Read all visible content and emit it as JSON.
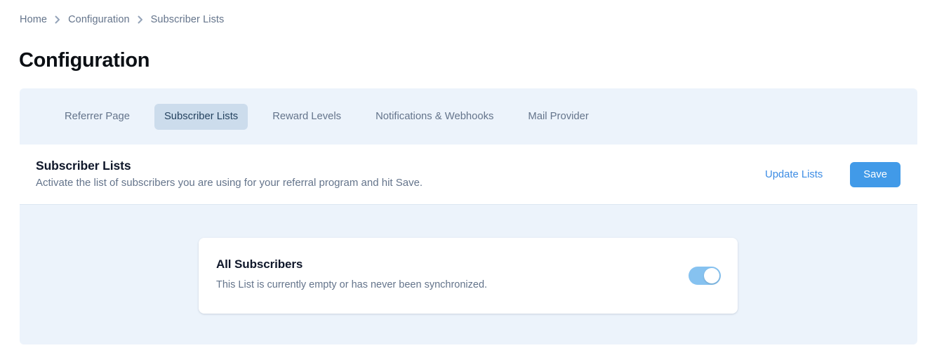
{
  "breadcrumb": {
    "items": [
      {
        "label": "Home"
      },
      {
        "label": "Configuration"
      },
      {
        "label": "Subscriber Lists"
      }
    ],
    "separator_icon": "chevron-right-icon"
  },
  "page_title": "Configuration",
  "tabs": [
    {
      "label": "Referrer Page",
      "active": false
    },
    {
      "label": "Subscriber Lists",
      "active": true
    },
    {
      "label": "Reward Levels",
      "active": false
    },
    {
      "label": "Notifications & Webhooks",
      "active": false
    },
    {
      "label": "Mail Provider",
      "active": false
    }
  ],
  "section": {
    "title": "Subscriber Lists",
    "description": "Activate the list of subscribers you are using for your referral program and hit Save.",
    "update_link_label": "Update Lists",
    "save_button_label": "Save"
  },
  "lists": [
    {
      "name": "All Subscribers",
      "status_text": "This List is currently empty or has never been synchronized.",
      "toggle_state": "on"
    }
  ],
  "colors": {
    "accent": "#419ae8",
    "link": "#3c8ce4",
    "panel_bg": "#ecf3fb",
    "active_tab_bg": "#ccdcec",
    "active_tab_text": "#24425f",
    "muted_text": "#64748b",
    "toggle_on": "#86c2f0"
  }
}
